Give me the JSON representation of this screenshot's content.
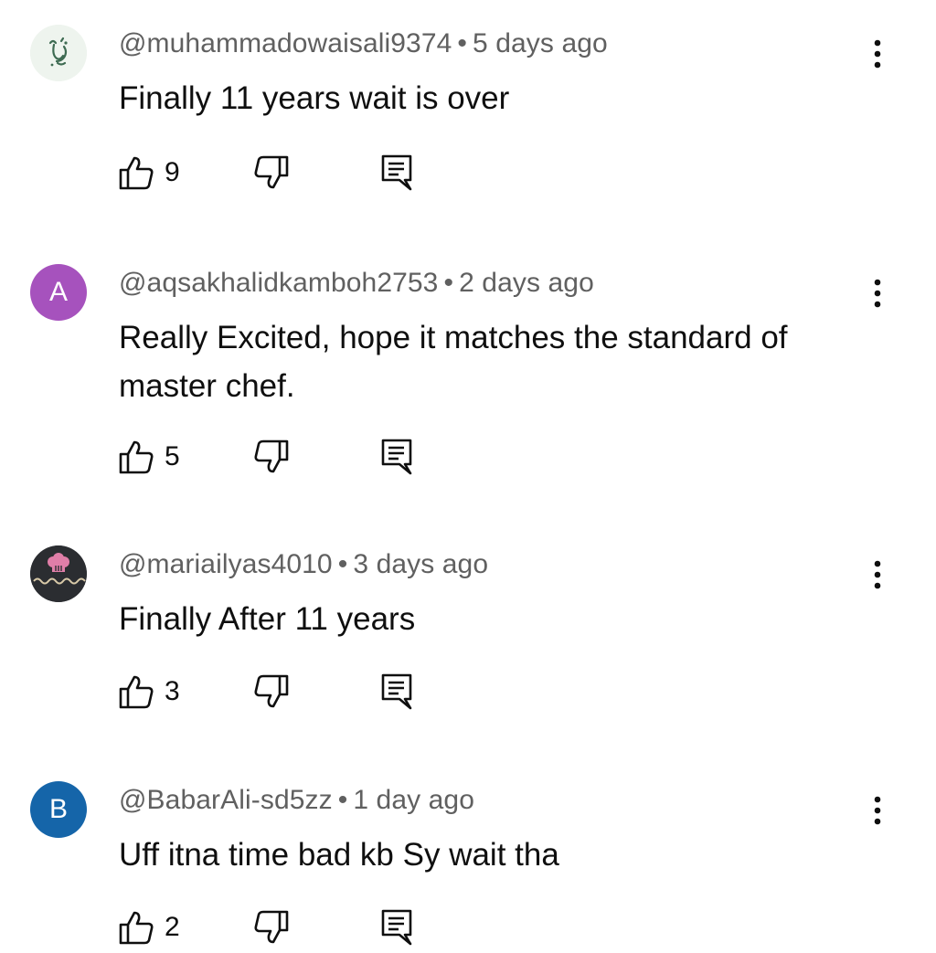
{
  "comments": [
    {
      "author": "@muhammadowaisali9374",
      "time": "5 days ago",
      "text": "Finally 11 years wait is over",
      "likes": "9",
      "avatar": {
        "type": "image",
        "bg": "#eef4ee"
      }
    },
    {
      "author": "@aqsakhalidkamboh2753",
      "time": "2 days ago",
      "text": "Really Excited, hope it matches the standard of master chef.",
      "likes": "5",
      "avatar": {
        "type": "letter",
        "letter": "A",
        "bg": "#a652bd"
      }
    },
    {
      "author": "@mariailyas4010",
      "time": "3 days ago",
      "text": "Finally After 11 years",
      "likes": "3",
      "avatar": {
        "type": "image",
        "bg": "#2b2d31"
      }
    },
    {
      "author": "@BabarAli-sd5zz",
      "time": "1 day ago",
      "text": "Uff itna time bad kb Sy wait tha",
      "likes": "2",
      "avatar": {
        "type": "letter",
        "letter": "B",
        "bg": "#1565a9"
      }
    }
  ],
  "icons": {
    "like": "thumb-up-icon",
    "dislike": "thumb-down-icon",
    "reply": "reply-comment-icon",
    "more": "more-vertical-icon"
  },
  "meta_separator": "•"
}
